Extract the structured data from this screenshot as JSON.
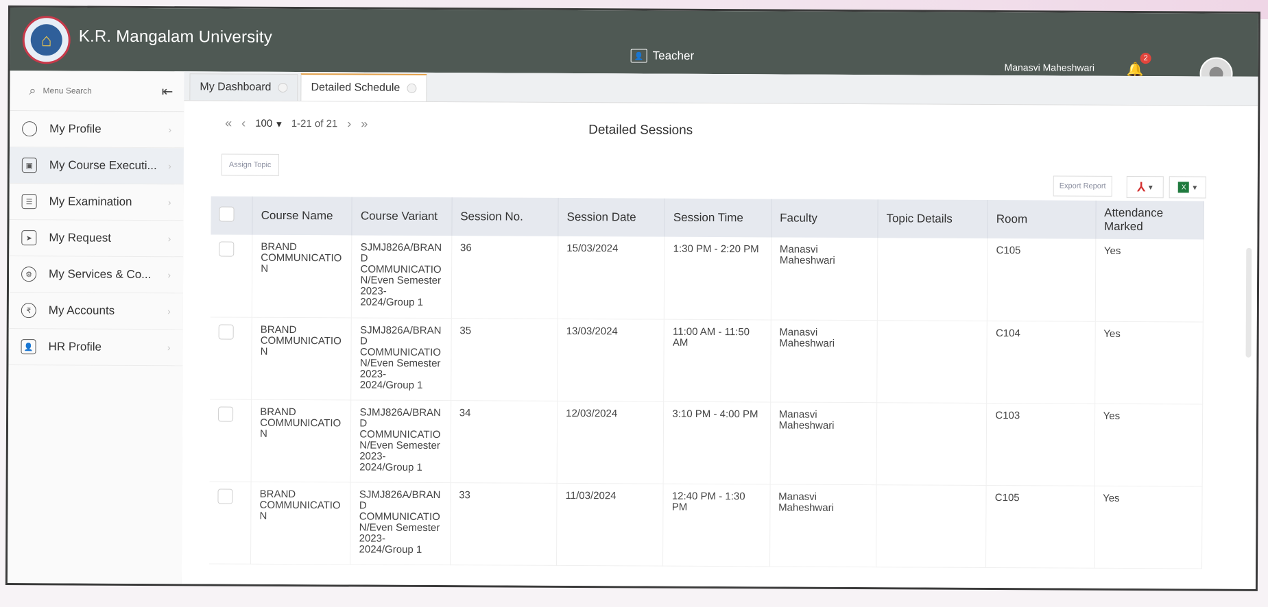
{
  "app": {
    "university": "K.R. Mangalam University",
    "role": "Teacher",
    "user_name": "Manasvi Maheshwari",
    "notification_count": "2"
  },
  "sidebar": {
    "search_placeholder": "Menu Search",
    "items": [
      {
        "label": "My Profile",
        "icon": "user-icon"
      },
      {
        "label": "My Course Executi...",
        "icon": "course-icon",
        "active": true
      },
      {
        "label": "My Examination",
        "icon": "exam-icon"
      },
      {
        "label": "My Request",
        "icon": "paper-plane-icon"
      },
      {
        "label": "My Services & Co...",
        "icon": "services-icon"
      },
      {
        "label": "My Accounts",
        "icon": "accounts-icon"
      },
      {
        "label": "HR Profile",
        "icon": "hr-icon"
      }
    ]
  },
  "tabs": [
    {
      "label": "My Dashboard"
    },
    {
      "label": "Detailed Schedule",
      "active": true
    }
  ],
  "pager": {
    "page_size": "100",
    "range": "1-21 of 21"
  },
  "main": {
    "title": "Detailed Sessions",
    "assign_topic": "Assign Topic",
    "export_report": "Export Report"
  },
  "table": {
    "headers": [
      "Course Name",
      "Course Variant",
      "Session No.",
      "Session Date",
      "Session Time",
      "Faculty",
      "Topic Details",
      "Room",
      "Attendance Marked"
    ],
    "rows": [
      {
        "course": "BRAND COMMUNICATIO N",
        "variant": "SJMJ826A/BRAN D COMMUNICATIO N/Even Semester 2023- 2024/Group 1",
        "session_no": "36",
        "date": "15/03/2024",
        "time": "1:30 PM - 2:20 PM",
        "faculty": "Manasvi Maheshwari",
        "topic": "",
        "room": "C105",
        "attendance": "Yes"
      },
      {
        "course": "BRAND COMMUNICATIO N",
        "variant": "SJMJ826A/BRAN D COMMUNICATIO N/Even Semester 2023- 2024/Group 1",
        "session_no": "35",
        "date": "13/03/2024",
        "time": "11:00 AM - 11:50 AM",
        "faculty": "Manasvi Maheshwari",
        "topic": "",
        "room": "C104",
        "attendance": "Yes"
      },
      {
        "course": "BRAND COMMUNICATIO N",
        "variant": "SJMJ826A/BRAN D COMMUNICATIO N/Even Semester 2023- 2024/Group 1",
        "session_no": "34",
        "date": "12/03/2024",
        "time": "3:10 PM - 4:00 PM",
        "faculty": "Manasvi Maheshwari",
        "topic": "",
        "room": "C103",
        "attendance": "Yes"
      },
      {
        "course": "BRAND COMMUNICATIO N",
        "variant": "SJMJ826A/BRAN D COMMUNICATIO N/Even Semester 2023- 2024/Group 1",
        "session_no": "33",
        "date": "11/03/2024",
        "time": "12:40 PM - 1:30 PM",
        "faculty": "Manasvi Maheshwari",
        "topic": "",
        "room": "C105",
        "attendance": "Yes"
      }
    ]
  },
  "colors": {
    "header_bg": "#4f5954",
    "active_tab_accent": "#e3a14a",
    "table_header_bg": "#e6e9ef",
    "badge": "#e2453c"
  }
}
